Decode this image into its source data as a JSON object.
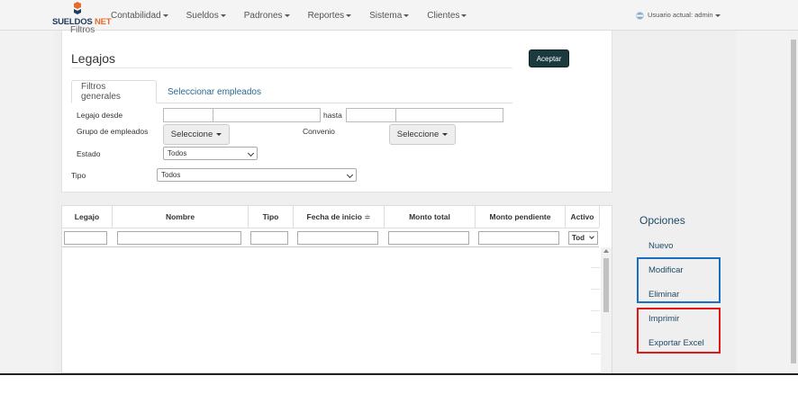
{
  "brand": {
    "name_a": "SUELDOS",
    "name_b": "NET"
  },
  "nav": {
    "items": [
      "Contabilidad",
      "Sueldos",
      "Padrones",
      "Reportes",
      "Sistema",
      "Clientes"
    ],
    "user": "Usuario actual: admin"
  },
  "filters": {
    "panel_heading": "Filtros",
    "title": "Legajos",
    "accept_label": "Aceptar",
    "tabs": [
      "Filtros generales",
      "Seleccionar empleados"
    ],
    "legajo_desde_label": "Legajo desde",
    "hasta_label": "hasta",
    "grupo_label": "Grupo de empleados",
    "grupo_button": "Seleccione",
    "convenio_label": "Convenio",
    "convenio_button": "Seleccione",
    "estado_label": "Estado",
    "estado_value": "Todos",
    "tipo_label": "Tipo",
    "tipo_value": "Todos"
  },
  "table": {
    "columns": [
      "Legajo",
      "Nombre",
      "Tipo",
      "Fecha de inicio",
      "Monto total",
      "Monto pendiente",
      "Activo"
    ],
    "sort_indicator": "≑",
    "activo_filter": "Tod"
  },
  "options": {
    "title": "Opciones",
    "items": [
      "Nuevo",
      "Modificar",
      "Eliminar",
      "Imprimir",
      "Exportar Excel"
    ]
  },
  "colors": {
    "highlight_blue": "#1a6fc0",
    "highlight_red": "#e01818",
    "accent": "#1b3a3d"
  }
}
